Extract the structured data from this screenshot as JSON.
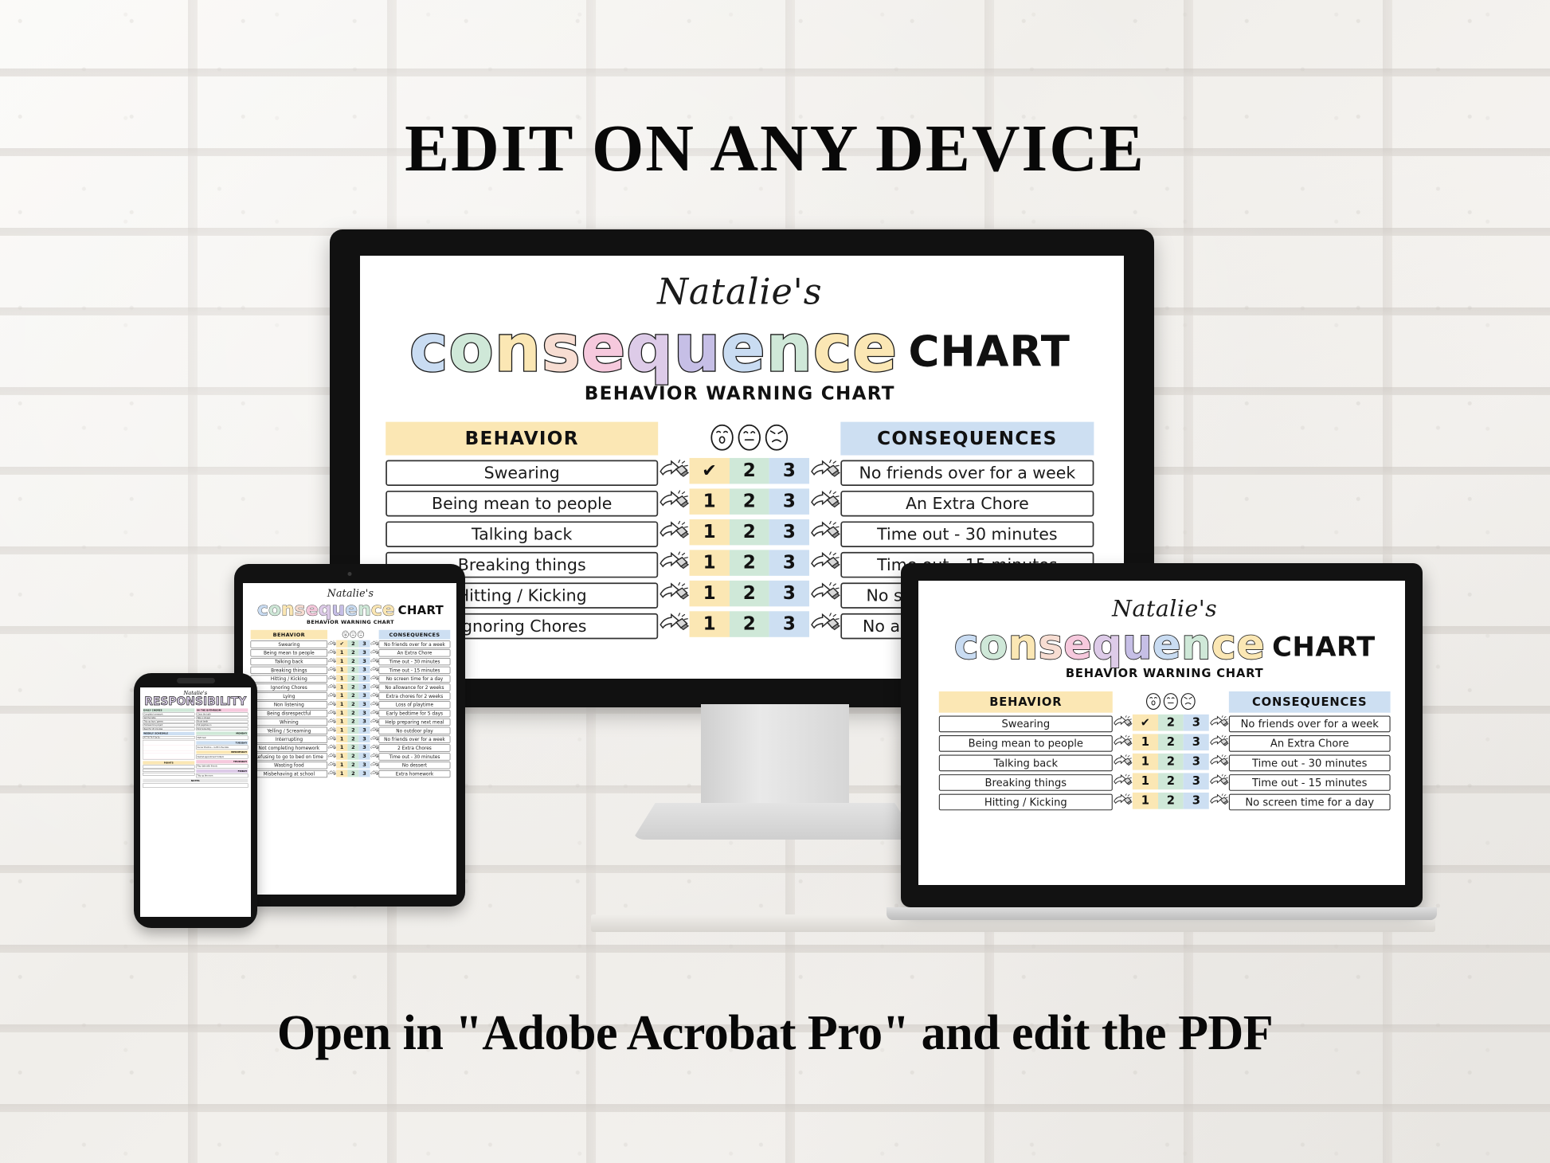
{
  "headings": {
    "top": "EDIT ON ANY DEVICE",
    "bottom": "Open in \"Adobe Acrobat Pro\" and edit the PDF"
  },
  "colors": {
    "yellow": "#fbe7b4",
    "green": "#cfe8d8",
    "blue": "#cddff2",
    "header_blue": "#cddff2",
    "ink": "#1a1a1a"
  },
  "document": {
    "owner_name": "Natalie's",
    "title_word": "consequence",
    "title_suffix": "CHART",
    "subtitle": "BEHAVIOR WARNING CHART",
    "title_letters": [
      {
        "char": "c",
        "color": "#c9dcf2"
      },
      {
        "char": "o",
        "color": "#cfe8d8"
      },
      {
        "char": "n",
        "color": "#fbe7b4"
      },
      {
        "char": "s",
        "color": "#f7ddd2"
      },
      {
        "char": "e",
        "color": "#f6c9dd"
      },
      {
        "char": "q",
        "color": "#ddcbe8"
      },
      {
        "char": "u",
        "color": "#c6bfe6"
      },
      {
        "char": "e",
        "color": "#c9dcf2"
      },
      {
        "char": "n",
        "color": "#cfe8d8"
      },
      {
        "char": "c",
        "color": "#fbe7b4"
      },
      {
        "char": "e",
        "color": "#fbe7b4"
      }
    ],
    "columns": {
      "behavior": "BEHAVIOR",
      "consequences": "CONSEQUENCES"
    },
    "warning_numbers": [
      "1",
      "2",
      "3"
    ],
    "face_icons": [
      "shocked-face-icon",
      "sad-face-icon",
      "angry-face-icon"
    ],
    "arrow_icon": "pencil-arrow-icon",
    "rows": [
      {
        "behavior": "Swearing",
        "n1": "✔",
        "n2": "2",
        "n3": "3",
        "consequence": "No friends over for a week"
      },
      {
        "behavior": "Being mean to people",
        "n1": "1",
        "n2": "2",
        "n3": "3",
        "consequence": "An Extra Chore"
      },
      {
        "behavior": "Talking back",
        "n1": "1",
        "n2": "2",
        "n3": "3",
        "consequence": "Time out - 30 minutes"
      },
      {
        "behavior": "Breaking things",
        "n1": "1",
        "n2": "2",
        "n3": "3",
        "consequence": "Time out - 15 minutes"
      },
      {
        "behavior": "Hitting / Kicking",
        "n1": "1",
        "n2": "2",
        "n3": "3",
        "consequence": "No screen time for a day"
      },
      {
        "behavior": "Ignoring Chores",
        "n1": "1",
        "n2": "2",
        "n3": "3",
        "consequence": "No allowance for 2 weeks"
      },
      {
        "behavior": "Lying",
        "n1": "1",
        "n2": "2",
        "n3": "3",
        "consequence": "Extra chores for 2 weeks"
      },
      {
        "behavior": "Non listening",
        "n1": "1",
        "n2": "2",
        "n3": "3",
        "consequence": "Loss of playtime"
      },
      {
        "behavior": "Being disrespectful",
        "n1": "1",
        "n2": "2",
        "n3": "3",
        "consequence": "Early bedtime for 5 days"
      },
      {
        "behavior": "Whining",
        "n1": "1",
        "n2": "2",
        "n3": "3",
        "consequence": "Help preparing next meal"
      },
      {
        "behavior": "Yelling / Screaming",
        "n1": "1",
        "n2": "2",
        "n3": "3",
        "consequence": "No outdoor play"
      },
      {
        "behavior": "Interrupting",
        "n1": "1",
        "n2": "2",
        "n3": "3",
        "consequence": "No friends over for a week"
      },
      {
        "behavior": "Not completing homework",
        "n1": "1",
        "n2": "2",
        "n3": "3",
        "consequence": "2 Extra Chores"
      },
      {
        "behavior": "Refusing to go to bed on time",
        "n1": "1",
        "n2": "2",
        "n3": "3",
        "consequence": "Time out - 30 minutes"
      },
      {
        "behavior": "Wasting food",
        "n1": "1",
        "n2": "2",
        "n3": "3",
        "consequence": "No dessert"
      },
      {
        "behavior": "Misbehaving at school",
        "n1": "1",
        "n2": "2",
        "n3": "3",
        "consequence": "Extra homework"
      }
    ]
  },
  "phone_document": {
    "owner_name": "Natalie's",
    "title": "RESPONSIBILITY",
    "sections": {
      "chores": "DAILY CHORES",
      "bathroom": "IN THE BATHROOM",
      "weekly": "WEEKLY SCHEDULE",
      "notes": "NOTES",
      "monday": "MONDAY",
      "tuesday": "TUESDAY",
      "wednesday": "WEDNESDAY",
      "thursday": "THURSDAY",
      "friday": "FRIDAY",
      "points": "POINTS"
    },
    "chore_items": [
      "Complete homework",
      "Set the table",
      "Tidy up toys / games",
      "Homework & project",
      "Read for 20 minutes"
    ],
    "bathroom_items": [
      "Clean the bath",
      "Take a shower",
      "Brush teeth",
      "Put pajamas on",
      "Pick home tidy"
    ],
    "week_days": [
      "M",
      "T",
      "W",
      "Th",
      "F",
      "Sa",
      "Su"
    ],
    "schedule": [
      {
        "day": "MONDAY",
        "text": "Math test"
      },
      {
        "day": "TUESDAY",
        "text": "Soccer Practice - confirm the date"
      },
      {
        "day": "WEDNESDAY",
        "text": "Dentist appointment 5.00pm"
      },
      {
        "day": "THURSDAY",
        "text": "Play date with friends"
      },
      {
        "day": "FRIDAY",
        "text": "Tidy up the room"
      }
    ],
    "points_rows": [
      "",
      "",
      ""
    ],
    "notes_label": "NOTES"
  },
  "devices": {
    "monitor": "desktop-monitor",
    "tablet": "tablet-device",
    "phone": "phone-device",
    "laptop": "laptop-device"
  }
}
